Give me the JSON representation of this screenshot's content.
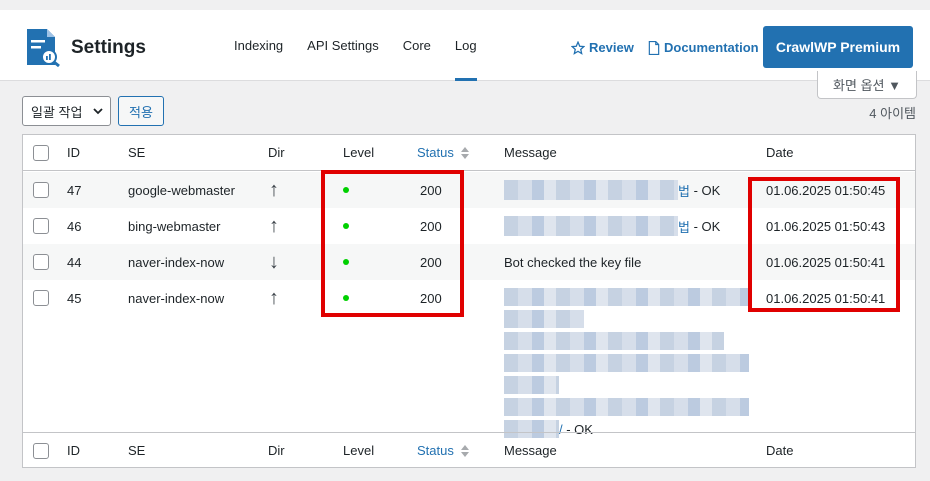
{
  "header": {
    "title": "Settings",
    "tabs": [
      {
        "label": "Indexing",
        "active": false
      },
      {
        "label": "API Settings",
        "active": false
      },
      {
        "label": "Core",
        "active": false
      },
      {
        "label": "Log",
        "active": true
      }
    ],
    "review_label": "Review",
    "documentation_label": "Documentation",
    "premium_label": "CrawlWP Premium"
  },
  "screen_options_label": "화면 옵션 ▼",
  "toolbar": {
    "bulk_action_label": "일괄 작업",
    "apply_label": "적용",
    "items_count": "4 아이템"
  },
  "table": {
    "columns": [
      "ID",
      "SE",
      "Dir",
      "Level",
      "Status",
      "Message",
      "Date"
    ],
    "rows": [
      {
        "id": "47",
        "se": "google-webmaster",
        "dir": "up",
        "status": "200",
        "message_suffix_link": "법",
        "message_suffix": " - OK",
        "date": "01.06.2025 01:50:45"
      },
      {
        "id": "46",
        "se": "bing-webmaster",
        "dir": "up",
        "status": "200",
        "message_suffix_link": "법",
        "message_suffix": " - OK",
        "date": "01.06.2025 01:50:43"
      },
      {
        "id": "44",
        "se": "naver-index-now",
        "dir": "down",
        "status": "200",
        "message": "Bot checked the key file",
        "date": "01.06.2025 01:50:41"
      },
      {
        "id": "45",
        "se": "naver-index-now",
        "dir": "up",
        "status": "200",
        "message_suffix_link": "/",
        "message_suffix": " - OK",
        "date": "01.06.2025 01:50:41"
      }
    ]
  },
  "colors": {
    "accent": "#2271b1",
    "highlight": "#e00000",
    "level_ok": "#00d000"
  },
  "icons": {
    "up": "↑",
    "down": "↓",
    "star": "star-icon",
    "doc": "document-icon",
    "logo": "crawlwp-logo-icon"
  }
}
